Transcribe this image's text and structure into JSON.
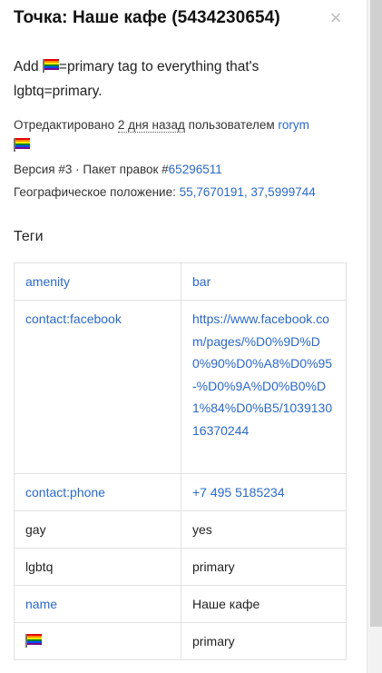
{
  "header": {
    "title": "Точка: Наше кафе (5434230654)",
    "close_glyph": "×"
  },
  "comment": {
    "prefix": "Add ",
    "suffix": "=primary tag to everything that's lgbtq=primary."
  },
  "meta": {
    "edited_prefix": "Отредактировано ",
    "edited_when": "2 дня назад",
    "edited_mid": " пользователем ",
    "user": "rorym",
    "version_text": "Версия #3 · Пакет правок #",
    "changeset": "65296511",
    "location_label": "Географическое положение: ",
    "location_value": "55,7670191, 37,5999744"
  },
  "tags": {
    "heading": "Теги",
    "rows": [
      {
        "key": "amenity",
        "value": "bar"
      },
      {
        "key": "contact:facebook",
        "value": "https://www.facebook.com/pages/%D0%9D%D0%90%D0%A8%D0%95-%D0%9A%D0%B0%D1%84%D0%B5/103913016370244"
      },
      {
        "key": "contact:phone",
        "value": "+7 495 5185234"
      },
      {
        "key": "gay",
        "value": "yes"
      },
      {
        "key": "lgbtq",
        "value": "primary"
      },
      {
        "key": "name",
        "value": "Наше кафе"
      },
      {
        "key": "",
        "value": "primary"
      }
    ]
  },
  "icons": {
    "flag": "rainbow-flag-icon",
    "close": "close-icon"
  },
  "colors": {
    "link": "#2b69c7",
    "flag_stripes": [
      "#e40303",
      "#ff8c00",
      "#ffed00",
      "#008026",
      "#004dff",
      "#750787"
    ]
  }
}
